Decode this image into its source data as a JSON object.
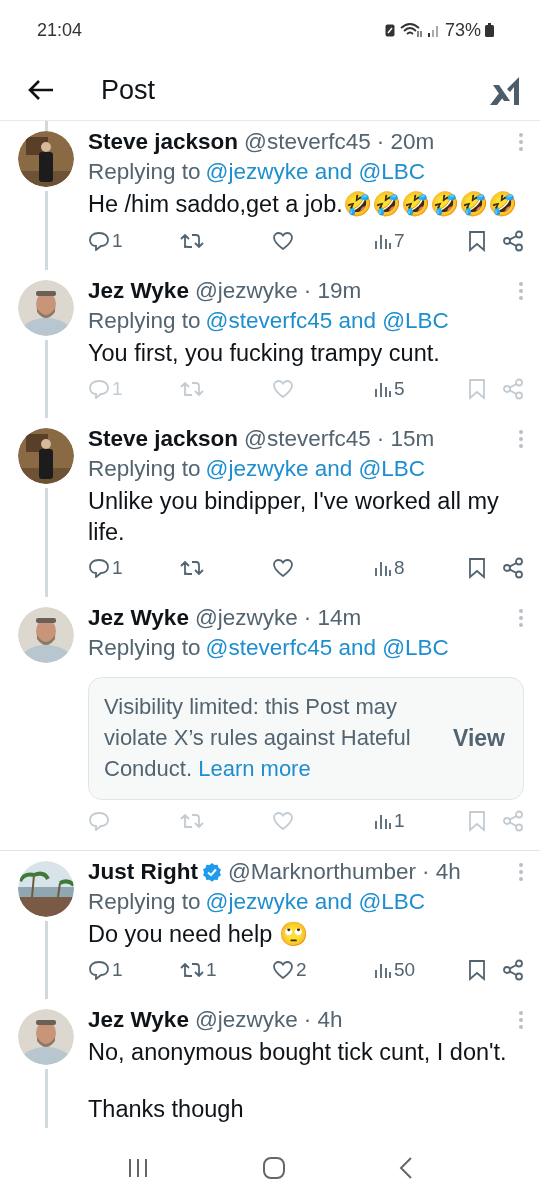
{
  "status_bar": {
    "time": "21:04",
    "battery": "73%"
  },
  "header": {
    "title": "Post"
  },
  "threads": [
    {
      "posts": [
        {
          "name": "Steve jackson",
          "handle": "@steverfc45",
          "time": "· 20m",
          "replying_label": "Replying to",
          "replying_to": "@jezwyke and @LBC",
          "body": [
            "He /him saddo,get a job.🤣🤣🤣🤣🤣🤣"
          ],
          "actions_dimmed": false,
          "replies": "1",
          "views": "7",
          "line_above": true,
          "line_below": true
        },
        {
          "name": "Jez Wyke",
          "handle": "@jezwyke",
          "time": "· 19m",
          "replying_label": "Replying to",
          "replying_to": "@steverfc45 and @LBC",
          "body": [
            "You first, you fucking trampy cunt."
          ],
          "actions_dimmed": true,
          "replies": "1",
          "views": "5",
          "line_below": true
        },
        {
          "name": "Steve jackson",
          "handle": "@steverfc45",
          "time": "· 15m",
          "replying_label": "Replying to",
          "replying_to": "@jezwyke and @LBC",
          "body": [
            "Unlike you bindipper, I've worked all my life."
          ],
          "actions_dimmed": false,
          "replies": "1",
          "views": "8",
          "line_below": true
        },
        {
          "name": "Jez Wyke",
          "handle": "@jezwyke",
          "time": "· 14m",
          "replying_label": "Replying to",
          "replying_to": "@steverfc45 and @LBC",
          "notice": {
            "text": "Visibility limited: this Post may violate X’s rules against Hateful Conduct.",
            "link": "Learn more",
            "action": "View"
          },
          "actions_dimmed": true,
          "views": "1"
        }
      ]
    },
    {
      "posts": [
        {
          "name": "Just Right",
          "verified": true,
          "handle": "@Marknorthumber",
          "time": "· 4h",
          "replying_label": "Replying to",
          "replying_to": "@jezwyke and @LBC",
          "body": [
            "Do you need help 🙄"
          ],
          "actions_dimmed": false,
          "replies": "1",
          "reposts": "1",
          "likes": "2",
          "views": "50",
          "line_below": true
        },
        {
          "name": "Jez Wyke",
          "handle": "@jezwyke",
          "time": "· 4h",
          "body": [
            "No, anonymous bought tick cunt, I don't.",
            "Thanks though"
          ],
          "line_below": true
        }
      ]
    }
  ]
}
